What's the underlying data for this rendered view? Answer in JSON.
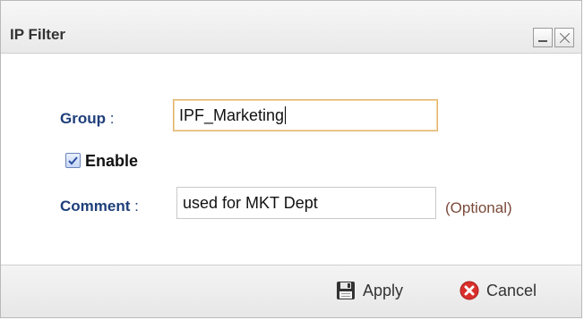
{
  "dialog": {
    "title": "IP Filter"
  },
  "form": {
    "group_label": "Group",
    "group_colon": ":",
    "group_value": "IPF_Marketing",
    "enable_label": "Enable",
    "enable_checked": true,
    "comment_label": "Comment",
    "comment_colon": ":",
    "comment_value": "used for MKT Dept",
    "optional_note": "(Optional)"
  },
  "footer": {
    "apply_label": "Apply",
    "cancel_label": "Cancel"
  },
  "icons": {
    "apply": "save-icon",
    "cancel": "cancel-icon",
    "minimize": "minimize-icon",
    "close": "close-icon"
  },
  "colors": {
    "label_blue": "#1e3f7a",
    "focus_border": "#e2b06a",
    "optional_text": "#7a4a3a",
    "cancel_red": "#d9302c"
  }
}
